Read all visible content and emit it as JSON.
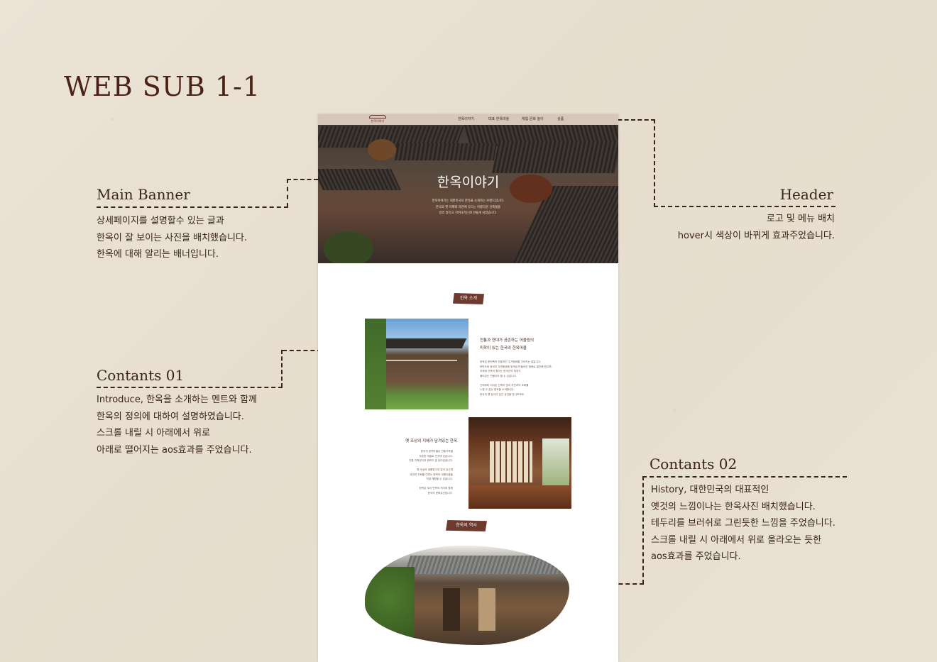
{
  "page_title": "WEB SUB 1-1",
  "annotations": {
    "main_banner": {
      "title": "Main Banner",
      "lines": [
        "상세페이지를 설명할수 있는 글과",
        "한옥이 잘 보이는 사진을 배치했습니다.",
        "한옥에 대해 알리는 배너입니다."
      ]
    },
    "header": {
      "title": "Header",
      "lines": [
        "로고 및 메뉴 배치",
        "hover시 색상이 바뀌게 효과주었습니다."
      ]
    },
    "contents_01": {
      "title": "Contants 01",
      "lines": [
        "Introduce, 한옥을 소개하는 멘트와 함께",
        "한옥의  정의에 대하여  설명하였습니다.",
        "스크롤 내릴 시 아래에서 위로",
        "아래로 떨어지는 aos효과를 주었습니다."
      ]
    },
    "contents_02": {
      "title": "Contants 02",
      "lines": [
        "History, 대한민국의 대표적인",
        "옛것의 느낌이나는 한옥사진 배치했습니다.",
        "테두리를 브러쉬로 그린듯한 느낌을 주었습니다.",
        "스크롤 내릴 시 아래에서 위로 올라오는 듯한",
        "aos효과를 주었습니다."
      ]
    }
  },
  "mockup": {
    "logo_text": "한옥이야기",
    "nav": [
      "한옥이야기",
      "대표 한옥마을",
      "체험 문화 놀이",
      "상품"
    ],
    "banner": {
      "title": "한옥이야기",
      "lines": [
        "한옥이야기는 대한민국의 한옥을 소개하는 브랜드입니다.",
        "한국의 옛 지혜와 자연에 깃드는 아름다운 건축물을",
        "널리 알리고 지켜나가는데 만들게 되었습니다."
      ]
    },
    "section1_tag": "한옥 소개",
    "intro_heading": [
      "전통과 현대가 공존하는 어울림의",
      "미학이 있는 한국의 한옥마을"
    ],
    "intro_body": [
      "한옥은 한민족의 전통적인 주거형태를 가리키는 말입니다.",
      "한반도와 중국의 자연환경에 맞게끔 만들어진 형태로 발전해 왔으며,",
      "자재와 건축의 원리는 한국인의 체취가",
      "배어있는 건물이라 할 수 있습니다.",
      "",
      "선대부터 이어온 건축의 멋과 자연과의 조화를",
      "느낄 수 있는 한옥을 소개합니다.",
      "한국의 옛 정서가 담긴 공간을 만나보세요."
    ],
    "history_heading": "옛 조상의 지혜가 담겨있는 한옥",
    "history_body": [
      "한국의 한옥마을은 전통가옥을",
      "보존한 마을로 곳곳에 있습니다.",
      "전통 건축양식과 문화가 잘 남아있습니다.",
      "",
      "옛 조상의 생활방식이 담겨 있으며",
      "자연과 조화를 이루는 한옥의 아름다움을",
      "직접 체험할 수 있습니다.",
      "",
      "한옥은 우리 민족의 역사와 함께",
      "한국의 문화유산입니다."
    ],
    "section2_tag": "한옥의 역사"
  },
  "colors": {
    "background": "#e9e1d3",
    "text": "#3a2418",
    "title": "#4a2316",
    "tag": "#6e3a2e",
    "mock_header": "#d8c6bb"
  }
}
